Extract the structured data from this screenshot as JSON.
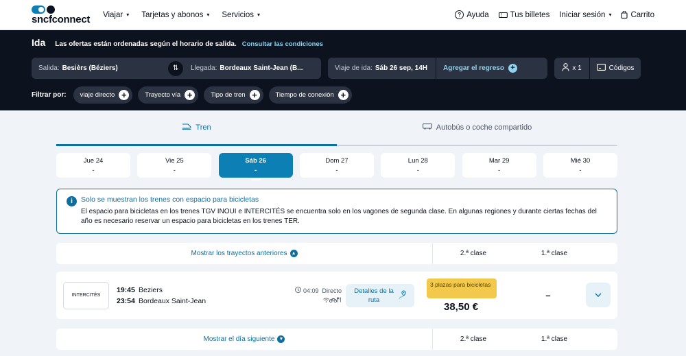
{
  "nav": {
    "logo": "sncfconnect",
    "items": [
      "Viajar",
      "Tarjetas y abonos",
      "Servicios"
    ],
    "help": "Ayuda",
    "tickets": "Tus billetes",
    "login": "Iniciar sesión",
    "cart": "Carrito"
  },
  "band": {
    "title": "Ida",
    "subtitle": "Las ofertas están ordenadas según el horario de salida.",
    "conditions_link": "Consultar las condiciones",
    "origin_label": "Salida:",
    "origin_value": "Besièrs (Béziers)",
    "dest_label": "Llegada:",
    "dest_value": "Bordeaux Saint-Jean (B...",
    "date_label": "Viaje de ida:",
    "date_value": "Sáb 26 sep, 14H",
    "return_label": "Agregar el regreso",
    "passengers": "x 1",
    "codes": "Códigos",
    "filter_label": "Filtrar por:",
    "filters": [
      "viaje directo",
      "Trayecto vía",
      "Tipo de tren",
      "Tiempo de conexión"
    ]
  },
  "tabs": {
    "train": "Tren",
    "bus": "Autobús o coche compartido"
  },
  "dates": [
    {
      "day": "Jue 24",
      "value": "-"
    },
    {
      "day": "Vie 25",
      "value": "-"
    },
    {
      "day": "Sáb 26",
      "value": "-"
    },
    {
      "day": "Dom 27",
      "value": "-"
    },
    {
      "day": "Lun 28",
      "value": "-"
    },
    {
      "day": "Mar 29",
      "value": "-"
    },
    {
      "day": "Mié 30",
      "value": "-"
    }
  ],
  "info": {
    "title": "Solo se muestran los trenes con espacio para bicicletas",
    "body": "El espacio para bicicletas en los trenes TGV INOUI e INTERCITÉS se encuentra solo en los vagones de segunda clase. En algunas regiones y durante ciertas fechas del año es necesario reservar un espacio para bicicletas en los trenes TER."
  },
  "results": {
    "previous_label": "Mostrar los trayectos anteriores",
    "next_label": "Mostrar el día siguiente",
    "class2": "2.ª clase",
    "class1": "1.ª clase"
  },
  "journey": {
    "operator": "INTERCITÉS",
    "dep_time": "19:45",
    "dep_station": "Beziers",
    "arr_time": "23:54",
    "arr_station": "Bordeaux Saint-Jean",
    "duration": "04:09",
    "type": "Directo",
    "details_label": "Detalles de la ruta",
    "seats_badge": "3 plazas para bicicletas",
    "price": "38,50 €",
    "first_class": "–"
  }
}
